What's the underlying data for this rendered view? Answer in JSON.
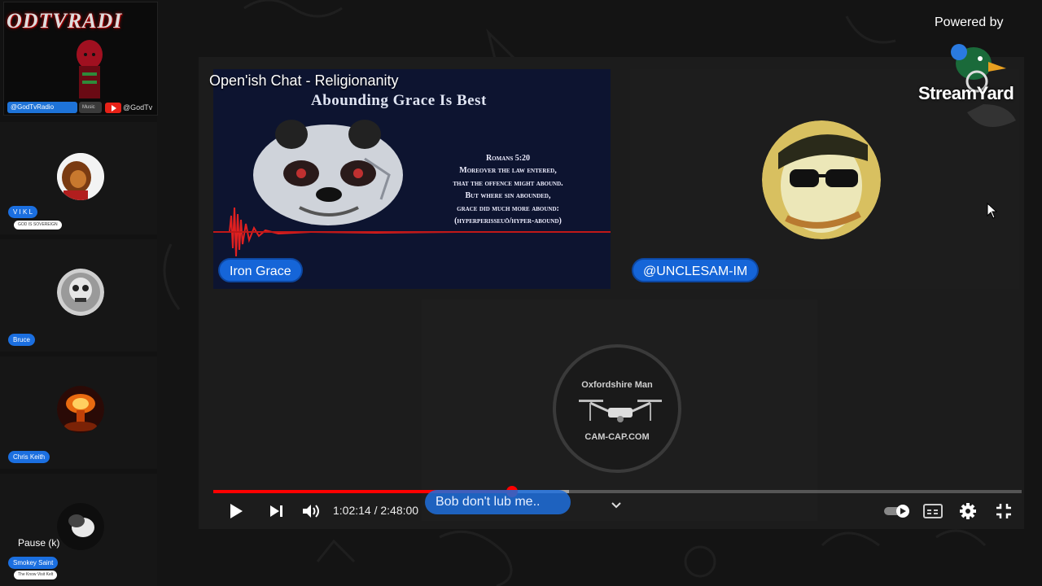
{
  "sidebar": {
    "channel_logo_text": "ODTVRADI",
    "channel_social_badge": "@GodTvRadio",
    "channel_social_badge_small": "Music",
    "channel_youtube_handle": "@GodTv",
    "guests": [
      {
        "name": "V I K L",
        "subtitle": "GOD IS SOVEREIGN"
      },
      {
        "name": "Bruce"
      },
      {
        "name": "Chris Keith"
      },
      {
        "name": "Smokey Saint",
        "subtitle": "The Know Visit Kelt"
      }
    ],
    "pause_tooltip": "Pause (k)"
  },
  "stage": {
    "stream_title": "Open'ish Chat - Religionanity",
    "tiles": [
      {
        "label": "Iron Grace",
        "heading": "Abounding Grace Is Best",
        "verse_lines": [
          "Romans 5:20",
          "Moreover the law entered,",
          "that the offence might abound.",
          "But where sin abounded,",
          "grace did much more abound:",
          "(hyperperisseuō/hyper-abound)"
        ]
      },
      {
        "label": "@UNCLESAM-IM"
      },
      {
        "logo_top": "Oxfordshire Man",
        "logo_bottom": "CAM-CAP.COM"
      }
    ]
  },
  "branding": {
    "powered_by": "Powered by",
    "name": "StreamYard"
  },
  "player": {
    "current_time": "1:02:14",
    "duration": "2:48:00",
    "time_display": "1:02:14 / 2:48:00",
    "played_fraction": 0.37,
    "buffered_fraction": 0.44,
    "chapter_title": "Bob don't lub me..",
    "icons": [
      "play-icon",
      "next-icon",
      "volume-icon",
      "chevron-down-icon",
      "autoplay-toggle",
      "captions-icon",
      "settings-icon",
      "exit-fullscreen-icon"
    ]
  },
  "colors": {
    "accent_blue": "#1565d8",
    "progress_red": "#ff0000",
    "background": "#141414"
  }
}
